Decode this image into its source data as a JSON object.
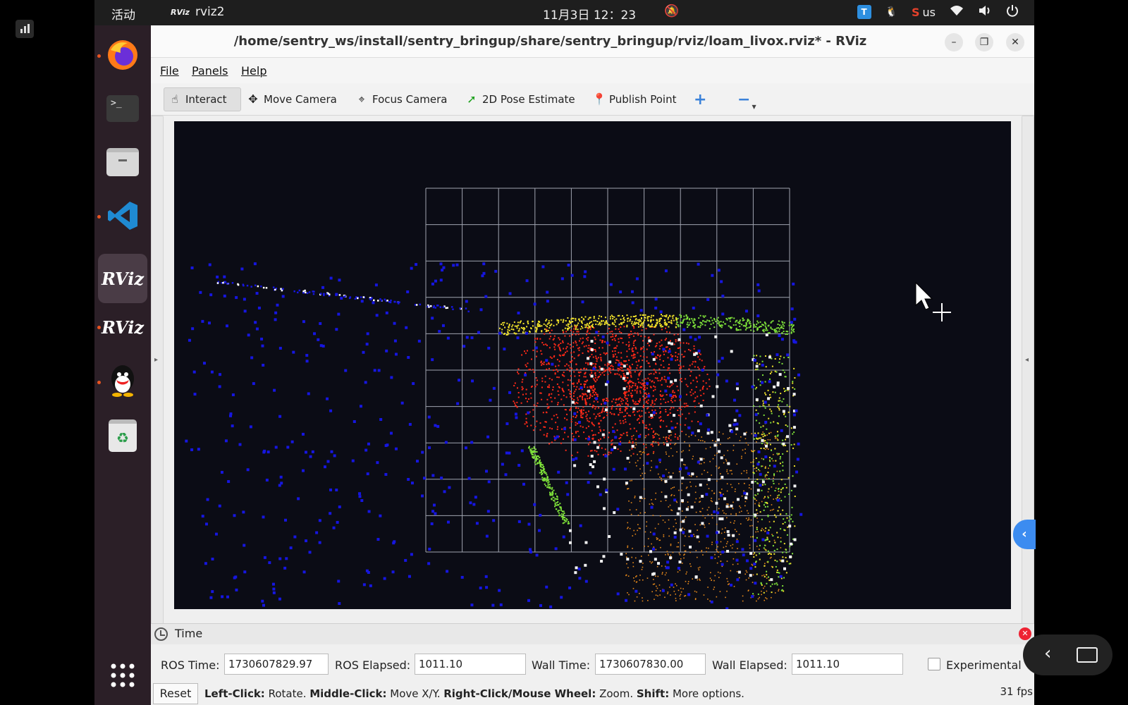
{
  "topbar": {
    "activities": "活动",
    "app_logo": "RViz",
    "app_name": "rviz2",
    "clock": "11月3日  12：23",
    "ime": "us",
    "icons": [
      "bell-muted-icon",
      "toolbox-icon",
      "qq-icon",
      "sogou-icon",
      "wifi-icon",
      "volume-icon",
      "power-icon"
    ]
  },
  "dock": {
    "items": [
      {
        "name": "firefox",
        "icon": "firefox-icon"
      },
      {
        "name": "terminal",
        "icon": "terminal-icon"
      },
      {
        "name": "files",
        "icon": "files-icon"
      },
      {
        "name": "vscode",
        "icon": "vscode-icon"
      },
      {
        "name": "rviz-active",
        "label": "RViz"
      },
      {
        "name": "rviz-2",
        "label": "RViz"
      },
      {
        "name": "qq",
        "icon": "qq-icon"
      },
      {
        "name": "trash",
        "icon": "trash-icon"
      },
      {
        "name": "app-grid",
        "icon": "app-grid-icon"
      }
    ]
  },
  "window": {
    "title": "/home/sentry_ws/install/sentry_bringup/share/sentry_bringup/rviz/loam_livox.rviz* - RViz"
  },
  "menu": {
    "file": "File",
    "panels": "Panels",
    "help": "Help"
  },
  "toolbar": {
    "interact": "Interact",
    "move_camera": "Move Camera",
    "focus_camera": "Focus Camera",
    "pose_estimate": "2D Pose Estimate",
    "publish_point": "Publish Point"
  },
  "time_panel": {
    "header": "Time",
    "ros_time_label": "ROS Time:",
    "ros_time": "1730607829.97",
    "ros_elapsed_label": "ROS Elapsed:",
    "ros_elapsed": "1011.10",
    "wall_time_label": "Wall Time:",
    "wall_time": "1730607830.00",
    "wall_elapsed_label": "Wall Elapsed:",
    "wall_elapsed": "1011.10",
    "experimental": "Experimental"
  },
  "statusbar": {
    "reset": "Reset",
    "hint_left_key": "Left-Click:",
    "hint_left": " Rotate. ",
    "hint_middle_key": "Middle-Click:",
    "hint_middle": " Move X/Y. ",
    "hint_right_key": "Right-Click/Mouse Wheel:",
    "hint_right": " Zoom. ",
    "hint_shift_key": "Shift:",
    "hint_shift": " More options.",
    "fps": "31 fps"
  },
  "colors": {
    "viewport_bg": "#0b0c15",
    "grid": "#a0a4b0",
    "points_red": "#ff2a18",
    "points_orange": "#e98a1a",
    "points_yellow": "#f2e32a",
    "points_green": "#7fe23a",
    "points_blue": "#1616e0",
    "accent": "#e95420"
  }
}
